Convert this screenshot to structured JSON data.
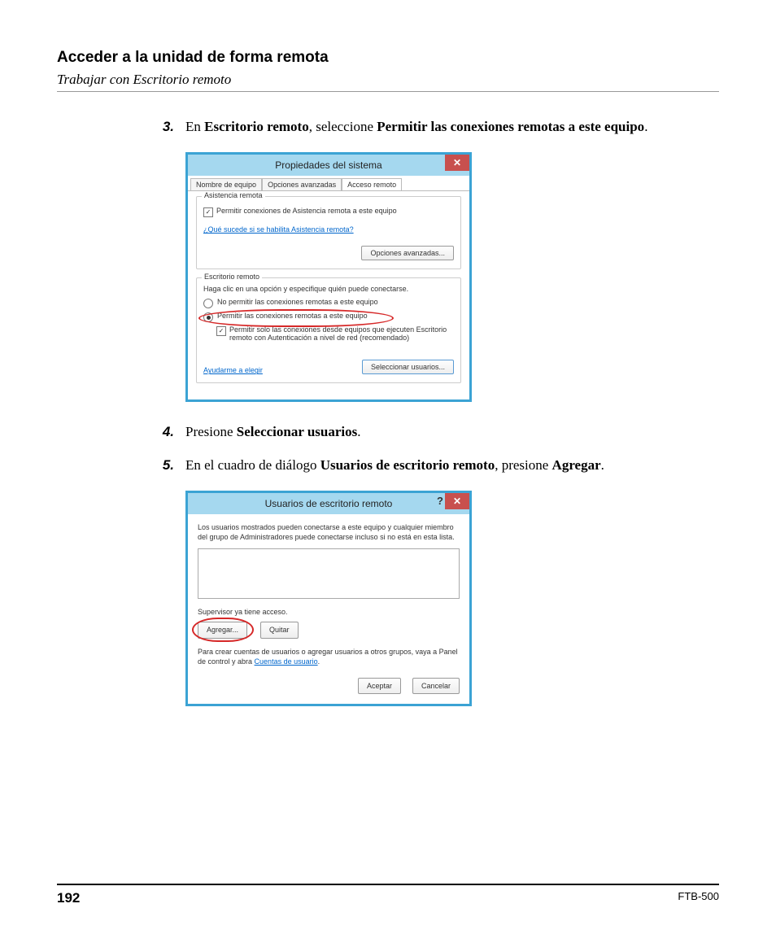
{
  "header": {
    "title": "Acceder a la unidad de forma remota",
    "subtitle": "Trabajar con Escritorio remoto"
  },
  "steps": {
    "s3": {
      "num": "3.",
      "pre": "En ",
      "b1": "Escritorio remoto",
      "mid": ", seleccione ",
      "b2": "Permitir las conexiones remotas a este equipo",
      "post": "."
    },
    "s4": {
      "num": "4.",
      "pre": "Presione ",
      "b1": "Seleccionar usuarios",
      "post": "."
    },
    "s5": {
      "num": "5.",
      "pre": "En el cuadro de diálogo ",
      "b1": "Usuarios de escritorio remoto",
      "mid": ", presione ",
      "b2": "Agregar",
      "post": "."
    }
  },
  "dlg1": {
    "title": "Propiedades del sistema",
    "close": "✕",
    "tabs": {
      "t1": "Nombre de equipo",
      "t2": "Opciones avanzadas",
      "t3": "Acceso remoto"
    },
    "grpA": {
      "label": "Asistencia remota",
      "chk": "Permitir conexiones de Asistencia remota a este equipo",
      "link": "¿Qué sucede si se habilita Asistencia remota?",
      "btn": "Opciones avanzadas..."
    },
    "grpB": {
      "label": "Escritorio remoto",
      "hint": "Haga clic en una opción y especifique quién puede conectarse.",
      "r1": "No permitir las conexiones remotas a este equipo",
      "r2": "Permitir las conexiones remotas a este equipo",
      "chk": "Permitir solo las conexiones desde equipos que ejecuten Escritorio remoto con Autenticación a nivel de red (recomendado)",
      "link": "Ayudarme a elegir",
      "btn": "Seleccionar usuarios..."
    }
  },
  "dlg2": {
    "title": "Usuarios de escritorio remoto",
    "help": "?",
    "close": "✕",
    "intro": "Los usuarios mostrados pueden conectarse a este equipo y cualquier miembro del grupo de Administradores puede conectarse incluso si no está en esta lista.",
    "access": "Supervisor ya tiene acceso.",
    "add": "Agregar...",
    "remove": "Quitar",
    "note_pre": "Para crear cuentas de usuarios o agregar usuarios a otros grupos, vaya a Panel de control y abra ",
    "note_link": "Cuentas de usuario",
    "note_post": ".",
    "ok": "Aceptar",
    "cancel": "Cancelar"
  },
  "footer": {
    "page": "192",
    "model": "FTB-500"
  }
}
